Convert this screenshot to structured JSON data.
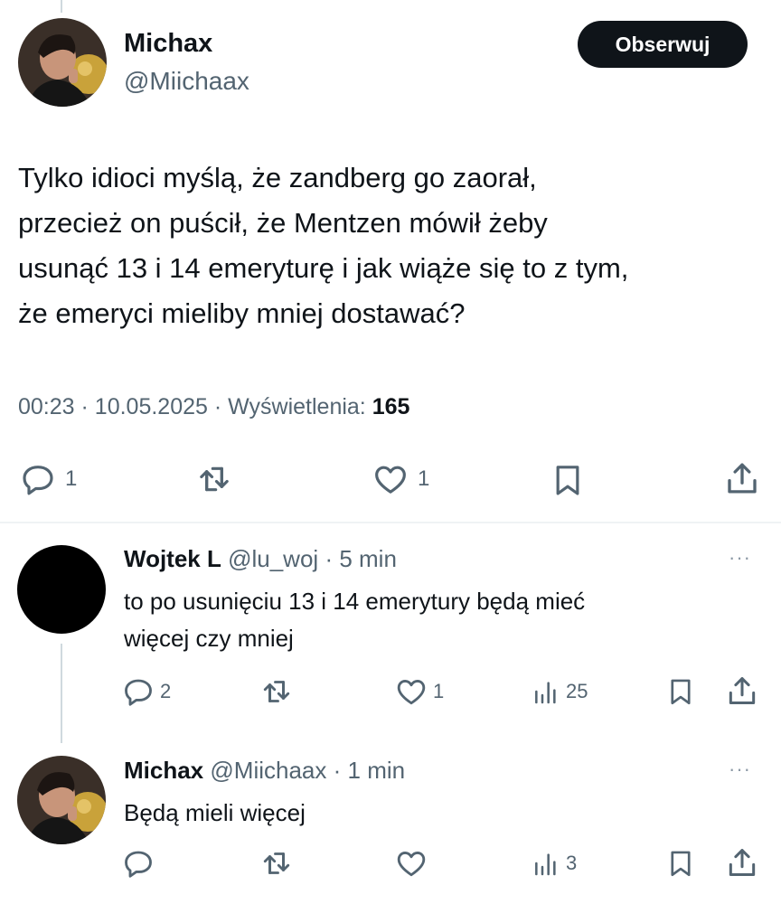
{
  "main_tweet": {
    "author_name": "Michax",
    "author_handle": "@Miichaax",
    "follow_label": "Obserwuj",
    "text": "Tylko idioci myślą, że zandberg go zaorał,\nprzecież on puścił, że Mentzen mówił żeby\nusunąć 13 i 14 emeryturę i jak wiąże się to z tym,\nże emeryci mieliby mniej dostawać?",
    "time": "00:23",
    "date": "10.05.2025",
    "views_label": "Wyświetlenia:",
    "views_count": "165",
    "reply_count": "1",
    "like_count": "1"
  },
  "replies": [
    {
      "author_name": "Wojtek L",
      "author_handle": "@lu_woj",
      "time": "5 min",
      "text": "to po usunięciu 13 i 14 emerytury będą mieć\nwięcej czy mniej",
      "reply_count": "2",
      "like_count": "1",
      "views_count": "25"
    },
    {
      "author_name": "Michax",
      "author_handle": "@Miichaax",
      "time": "1 min",
      "text": "Będą mieli więcej",
      "reply_count": "",
      "like_count": "",
      "views_count": "3"
    }
  ],
  "separator": "·",
  "more_glyph": "···",
  "colors": {
    "text": "#0f1419",
    "secondary": "#536471",
    "button_bg": "#0f1419",
    "divider": "#eff3f4",
    "thread_line": "#cfd9de"
  },
  "icons": [
    "reply-icon",
    "retweet-icon",
    "like-icon",
    "bookmark-icon",
    "share-icon",
    "views-icon",
    "more-icon"
  ]
}
